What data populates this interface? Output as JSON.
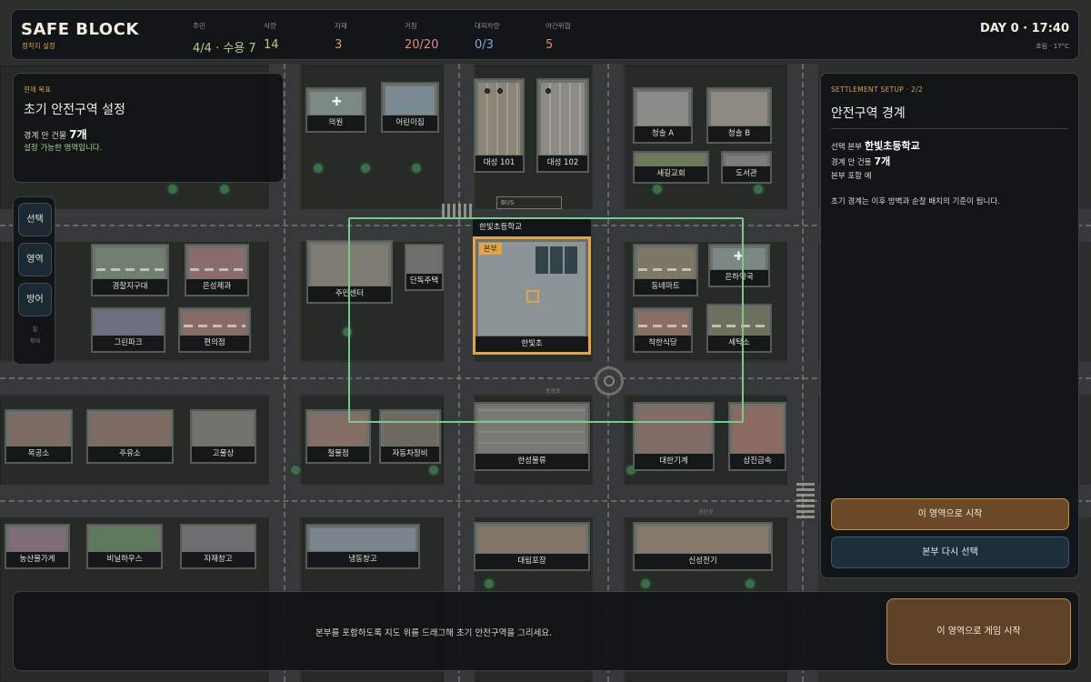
{
  "topbar": {
    "title": "SAFE BLOCK",
    "subtitle": "정착지 설정",
    "stats": [
      {
        "label": "주민",
        "value": "4/4 · 수용 7",
        "color": "#b6c98a"
      },
      {
        "label": "식량",
        "value": "14",
        "color": "#d8c26a"
      },
      {
        "label": "자재",
        "value": "3",
        "color": "#e39a56"
      },
      {
        "label": "거점",
        "value": "20/20",
        "color": "#e38a7a"
      },
      {
        "label": "대피차량",
        "value": "0/3",
        "color": "#8ba7d6"
      },
      {
        "label": "야간위협",
        "value": "5",
        "color": "#e3876a"
      }
    ],
    "day": "DAY 0 · 17:40",
    "weather": "흐림 · 17°C"
  },
  "goal": {
    "kicker": "현재 목표",
    "title": "초기 안전구역 설정",
    "boundary_label": "경계 안 건물",
    "boundary_value": "7개",
    "note": "설정 가능한 영역입니다."
  },
  "tools": {
    "items": [
      "선택",
      "영역",
      "방어"
    ],
    "small1": "힐",
    "small2": "확대"
  },
  "setup": {
    "kicker": "SETTLEMENT SETUP · 2/2",
    "title": "안전구역 경계",
    "hq_label": "선택 본부",
    "hq_value": "한빛초등학교",
    "count_label": "경계 안 건물",
    "count_value": "7개",
    "include_label": "본부 포함",
    "include_value": "예",
    "description": "초기 경계는 이후 방벽과 순찰 배치의 기준이 됩니다.",
    "primary_button": "이 영역으로 시작",
    "secondary_button": "본부 다시 선택"
  },
  "bottombar": {
    "hint": "본부를 포함하도록 지도 위를 드래그해 초기 안전구역을 그리세요.",
    "start_button": "이 영역으로 게임 시작"
  },
  "map": {
    "bus_label": "BUS",
    "school_title": "한빛초등학교",
    "hq_tag": "본부",
    "road_names": [
      "중앙로",
      "공단로"
    ],
    "buildings": [
      {
        "name": "의원",
        "color": "#7c8a86",
        "icon": "cross"
      },
      {
        "name": "어린이집",
        "color": "#7b8a92"
      },
      {
        "name": "대성 101",
        "color": "#8b8578"
      },
      {
        "name": "대성 102",
        "color": "#8c8a84"
      },
      {
        "name": "청솔 A",
        "color": "#8a8c88"
      },
      {
        "name": "청솔 B",
        "color": "#8e8a82"
      },
      {
        "name": "새길교회",
        "color": "#6c7a5a"
      },
      {
        "name": "도서관",
        "color": "#7a7c7e"
      },
      {
        "name": "경찰지구대",
        "color": "#6f8070"
      },
      {
        "name": "은성제과",
        "color": "#8a6c6c"
      },
      {
        "name": "그린파크",
        "color": "#6c7080"
      },
      {
        "name": "편의점",
        "color": "#8a6a66"
      },
      {
        "name": "주민센터",
        "color": "#7e7c72"
      },
      {
        "name": "단독주택",
        "color": "#6f6f6c"
      },
      {
        "name": "한빛초",
        "color": "#8c9497"
      },
      {
        "name": "동네마트",
        "color": "#7d7766"
      },
      {
        "name": "은하약국",
        "color": "#7c8886",
        "icon": "cross"
      },
      {
        "name": "착한식당",
        "color": "#8a6e63"
      },
      {
        "name": "세탁소",
        "color": "#6e705e"
      },
      {
        "name": "목공소",
        "color": "#7b6b62"
      },
      {
        "name": "주유소",
        "color": "#7d6a60"
      },
      {
        "name": "고물상",
        "color": "#6f756c"
      },
      {
        "name": "철물점",
        "color": "#836d64"
      },
      {
        "name": "자동차정비",
        "color": "#6e6760"
      },
      {
        "name": "한성물류",
        "color": "#777a74"
      },
      {
        "name": "대한기계",
        "color": "#846c66"
      },
      {
        "name": "삼진금속",
        "color": "#8a6a62"
      },
      {
        "name": "농산물가게",
        "color": "#7e6c78"
      },
      {
        "name": "비닐하우스",
        "color": "#5e7a5c"
      },
      {
        "name": "자재창고",
        "color": "#6c6e70"
      },
      {
        "name": "냉동창고",
        "color": "#7a8590"
      },
      {
        "name": "대림포장",
        "color": "#837668"
      },
      {
        "name": "신성전기",
        "color": "#85796a"
      }
    ]
  }
}
